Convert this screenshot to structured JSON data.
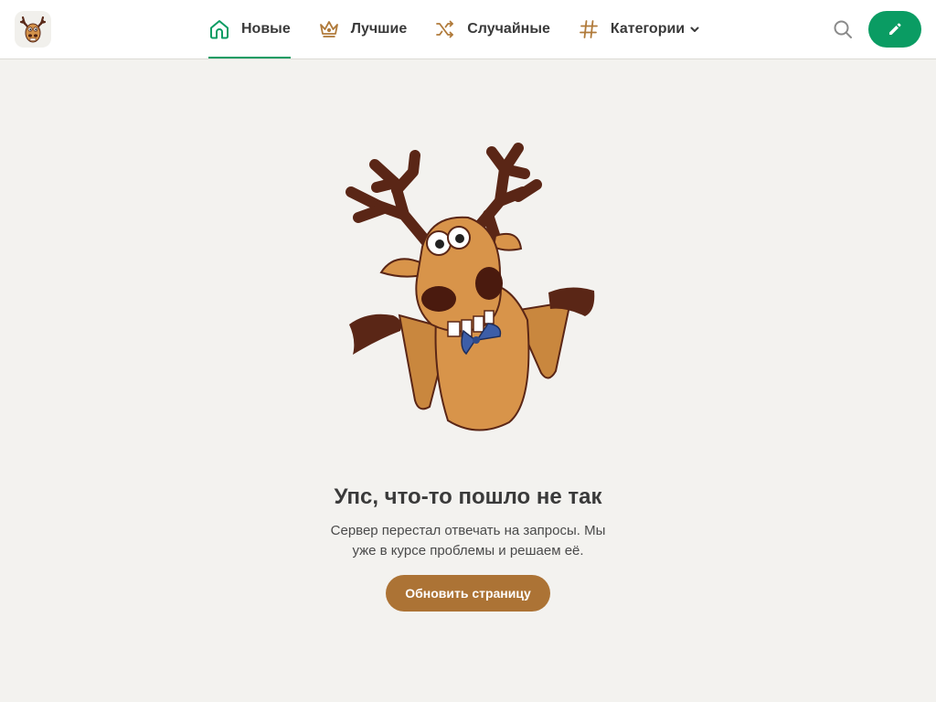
{
  "header": {
    "logo_icon": "moose-logo-icon",
    "nav": [
      {
        "label": "Новые",
        "icon": "home-icon",
        "active": true
      },
      {
        "label": "Лучшие",
        "icon": "crown-icon",
        "active": false
      },
      {
        "label": "Случайные",
        "icon": "shuffle-icon",
        "active": false
      },
      {
        "label": "Категории",
        "icon": "hash-icon",
        "active": false,
        "dropdown": true
      }
    ],
    "search_icon": "search-icon",
    "write_icon": "pencil-icon"
  },
  "error": {
    "illustration": "shrugging-moose",
    "title": "Упс, что-то пошло не так",
    "description": "Сервер перестал отвечать на запросы. Мы уже в курсе проблемы и решаем её.",
    "button_label": "Обновить страницу"
  },
  "colors": {
    "accent_green": "#0a9c63",
    "button_brown": "#ac7335",
    "background": "#f3f2ef",
    "icon_brown": "#b07a3a"
  }
}
